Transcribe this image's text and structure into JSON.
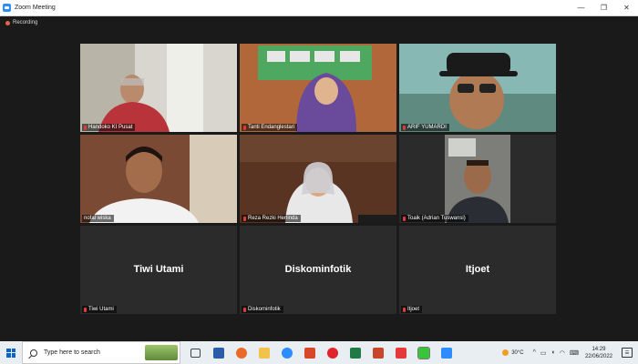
{
  "window": {
    "title": "Zoom Meeting"
  },
  "recording": {
    "label": "Recording"
  },
  "participants": [
    {
      "name": "Handoko KI Pusat",
      "has_video": true
    },
    {
      "name": "Tanti Endanglestari",
      "has_video": true
    },
    {
      "name": "ARIF YUMARDI",
      "has_video": true
    },
    {
      "name": "nofal wiska",
      "has_video": true,
      "active_speaker": true
    },
    {
      "name": "Reza Rezki Herlinda",
      "has_video": true
    },
    {
      "name": "Toaik (Adrian Tuswansi)",
      "has_video": true
    },
    {
      "name": "Tiwi Utami",
      "display_name": "Tiwi Utami",
      "has_video": false
    },
    {
      "name": "Diskominfotik",
      "display_name": "Diskominfotik",
      "has_video": false
    },
    {
      "name": "Itjoet",
      "display_name": "Itjoet",
      "has_video": false
    }
  ],
  "taskbar": {
    "search_placeholder": "Type here to search",
    "pinned_icons": [
      "task-view-icon",
      "word-icon",
      "firefox-icon",
      "file-explorer-icon",
      "zoom-icon",
      "office-icon",
      "opera-icon",
      "excel-icon",
      "powerpoint-icon",
      "wps-icon",
      "line-icon",
      "zoom-app-icon"
    ],
    "weather": "30°C",
    "time": "14:29",
    "date": "22/06/2022"
  },
  "colors": {
    "accent": "#2d8cff",
    "active_speaker_border": "#c8d43c",
    "muted_mic": "#e03a3a",
    "background": "#1a1a1a",
    "tile": "#2b2b2b"
  }
}
